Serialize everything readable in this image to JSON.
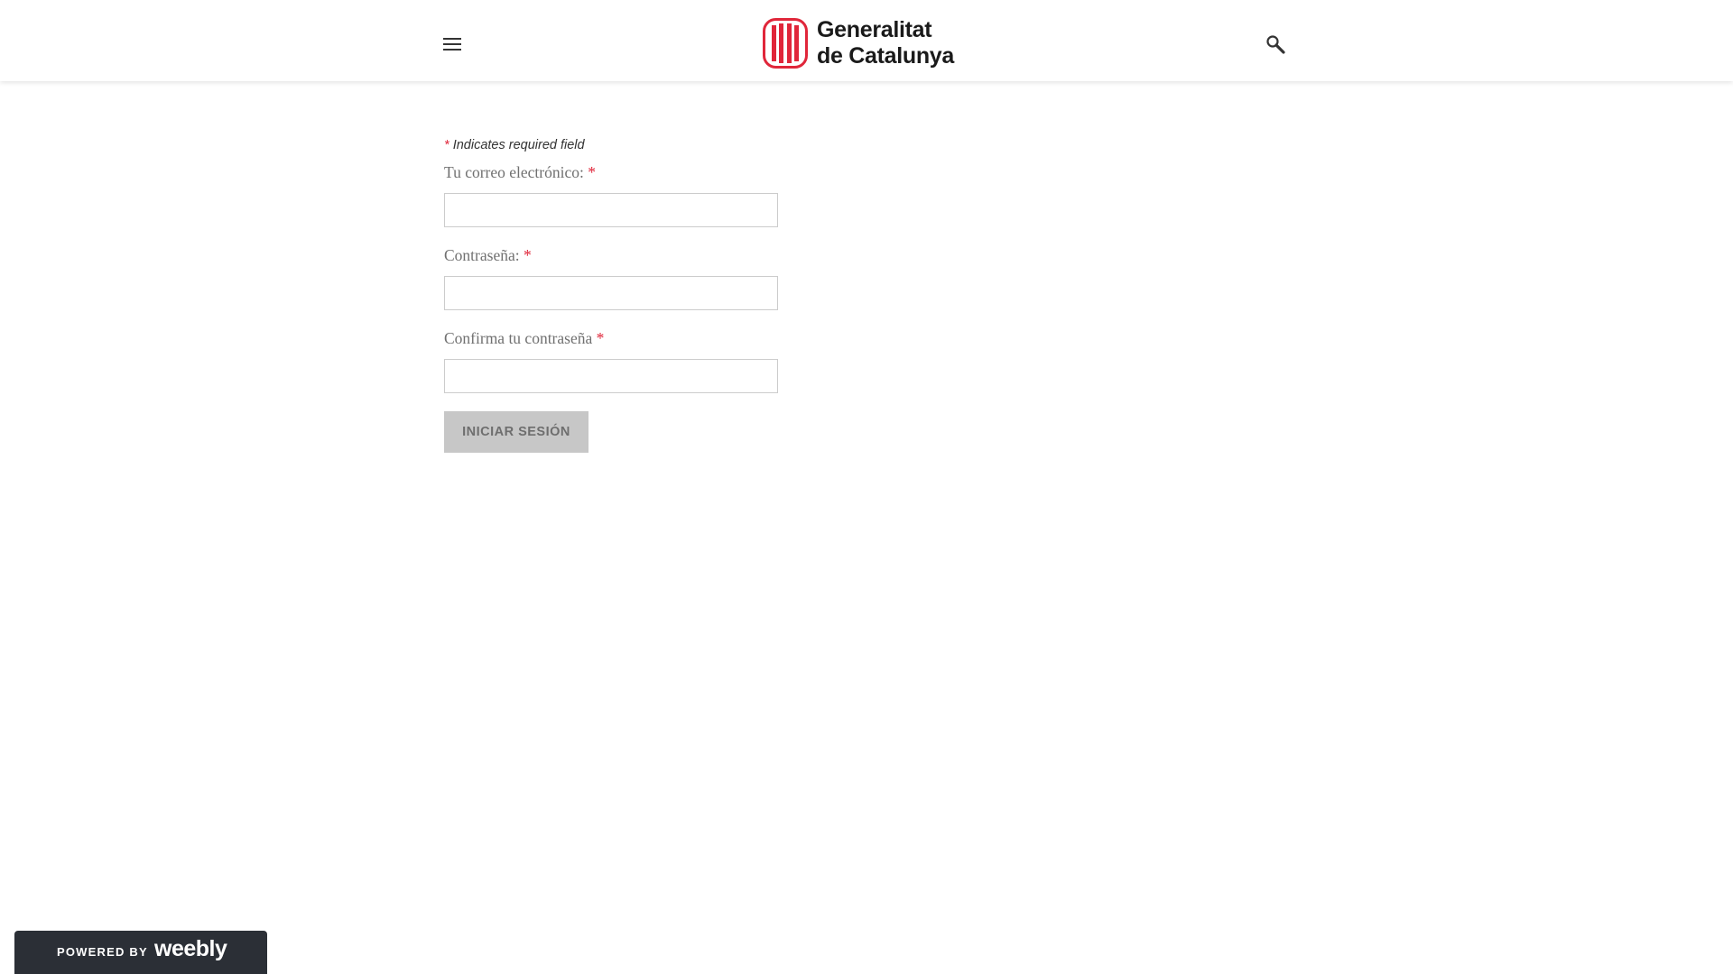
{
  "header": {
    "logo_line1": "Generalitat",
    "logo_line2": "de Catalunya",
    "menu_icon": "hamburger-menu-icon",
    "search_icon": "search-icon",
    "brand_color": "#e0263a"
  },
  "form": {
    "required_marker": "*",
    "required_note": "Indicates required field",
    "email_label": "Tu correo electrónico:",
    "email_value": "",
    "password_label": "Contraseña:",
    "password_value": "",
    "confirm_label": "Confirma tu contraseña",
    "confirm_value": "",
    "submit_label": "INICIAR SESIÓN"
  },
  "footer": {
    "powered_by": "POWERED BY",
    "wordmark": "weebly"
  }
}
